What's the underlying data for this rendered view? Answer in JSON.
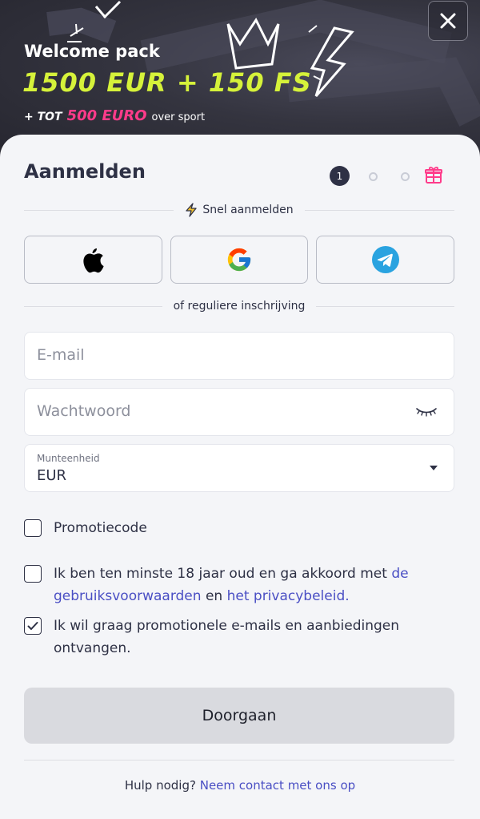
{
  "banner": {
    "title": "Welcome pack",
    "headline": "1500 EUR + 150 FS",
    "sport_prefix": "+ TOT",
    "sport_amount": "500 EURO",
    "sport_suffix": "over sport"
  },
  "header": {
    "close_icon": "close-icon"
  },
  "form": {
    "title": "Aanmelden",
    "steps": {
      "current": "1",
      "total_dots": 2,
      "final_icon": "gift-icon"
    },
    "quick_signup_label": "Snel aanmelden",
    "social_buttons": [
      {
        "name": "apple",
        "icon": "apple-icon"
      },
      {
        "name": "google",
        "icon": "google-icon"
      },
      {
        "name": "telegram",
        "icon": "telegram-icon"
      }
    ],
    "regular_signup_label": "of reguliere inschrijving",
    "email": {
      "placeholder": "E-mail",
      "value": ""
    },
    "password": {
      "placeholder": "Wachtwoord",
      "value": ""
    },
    "currency": {
      "label": "Munteenheid",
      "value": "EUR"
    },
    "promo_checkbox": {
      "label": "Promotiecode",
      "checked": false
    },
    "terms": {
      "checked": false,
      "text_before": "Ik ben ten minste 18 jaar oud en ga akkoord met ",
      "terms_link": "de gebruiksvoorwaarden",
      "text_middle": " en ",
      "privacy_link": "het privacybeleid."
    },
    "marketing": {
      "checked": true,
      "text": "Ik wil graag promotionele e-mails en aanbiedingen ontvangen."
    },
    "submit_label": "Doorgaan",
    "help_text": "Hulp nodig?",
    "help_link": "Neem contact met ons op"
  },
  "colors": {
    "accent_lime": "#d6f23a",
    "accent_pink": "#ff3b8a",
    "link": "#4a4fc4",
    "text": "#2e3145"
  }
}
